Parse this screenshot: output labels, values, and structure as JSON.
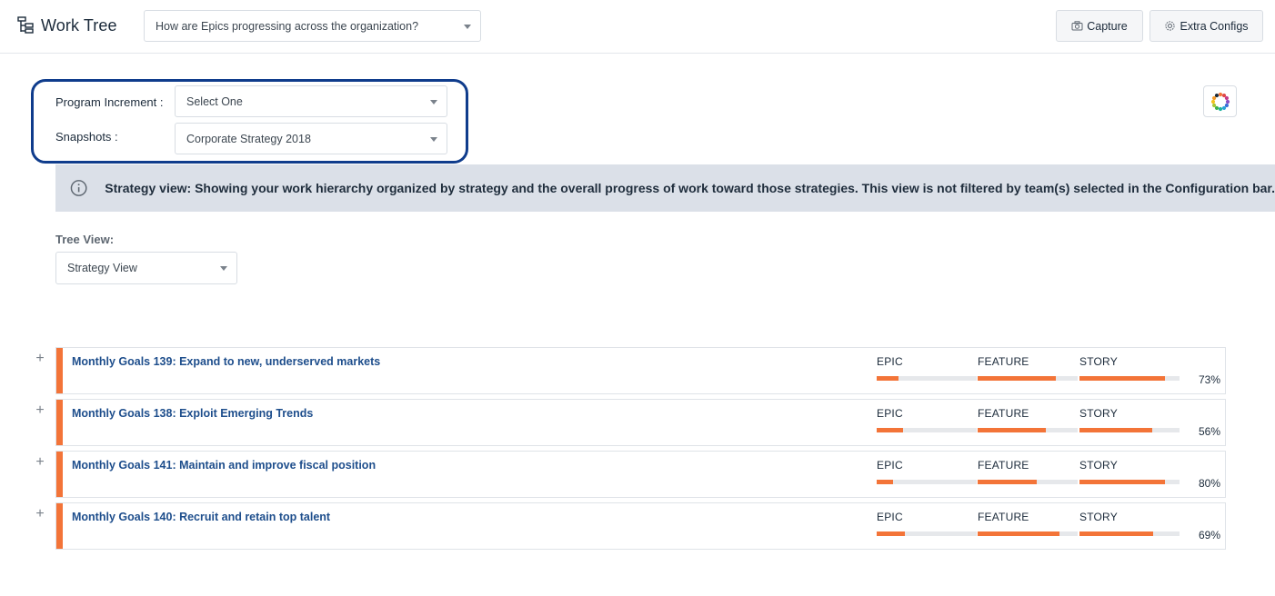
{
  "header": {
    "app_title": "Work Tree",
    "question_select": {
      "selected": "How are Epics progressing across the organization?"
    },
    "capture_label": "Capture",
    "configs_label": "Extra Configs"
  },
  "filters": {
    "program_increment_label": "Program Increment :",
    "program_increment_value": "Select One",
    "snapshots_label": "Snapshots :",
    "snapshots_value": "Corporate Strategy 2018"
  },
  "info_banner": {
    "text": "Strategy view: Showing your work hierarchy organized by strategy and the overall progress of work toward those strategies. This view is not filtered by team(s) selected in the Configuration bar."
  },
  "tree_view": {
    "label": "Tree View:",
    "value": "Strategy View"
  },
  "metric_labels": {
    "epic": "EPIC",
    "feature": "FEATURE",
    "story": "STORY"
  },
  "colors": {
    "accent": "#f37438",
    "brand_border": "#0f3c8c",
    "link": "#1e4e8c",
    "banner_bg": "#dbe0e8"
  },
  "goals": [
    {
      "title": "Monthly Goals 139: Expand to new, underserved markets",
      "epic": 0.22,
      "feature": 0.78,
      "story": 0.85,
      "percent": "73%"
    },
    {
      "title": "Monthly Goals 138: Exploit Emerging Trends",
      "epic": 0.26,
      "feature": 0.68,
      "story": 0.73,
      "percent": "56%"
    },
    {
      "title": "Monthly Goals 141: Maintain and improve fiscal position",
      "epic": 0.16,
      "feature": 0.59,
      "story": 0.85,
      "percent": "80%"
    },
    {
      "title": "Monthly Goals 140: Recruit and retain top talent",
      "epic": 0.28,
      "feature": 0.82,
      "story": 0.74,
      "percent": "69%"
    }
  ]
}
